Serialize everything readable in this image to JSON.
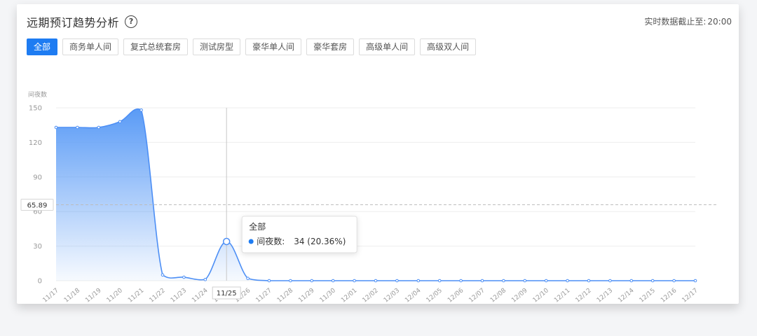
{
  "header": {
    "title": "远期预订趋势分析",
    "help_icon": "question-circle-icon",
    "cutoff_label": "实时数据截止至:",
    "cutoff_time": "20:00"
  },
  "tabs": [
    {
      "label": "全部",
      "active": true
    },
    {
      "label": "商务单人间",
      "active": false
    },
    {
      "label": "复式总统套房",
      "active": false
    },
    {
      "label": "测试房型",
      "active": false
    },
    {
      "label": "豪华单人间",
      "active": false
    },
    {
      "label": "豪华套房",
      "active": false
    },
    {
      "label": "高级单人间",
      "active": false
    },
    {
      "label": "高级双人间",
      "active": false
    }
  ],
  "colors": {
    "accent": "#1e7cf2",
    "line": "#4d8ff5",
    "area_top": "#5a9bf6",
    "grid": "#eeeeee",
    "axis_text": "#999999"
  },
  "chart_data": {
    "type": "area",
    "ylabel": "间夜数",
    "ylim": [
      0,
      150
    ],
    "yticks": [
      "150",
      "120",
      "90",
      "60",
      "30",
      "0"
    ],
    "categories": [
      "11/17",
      "11/18",
      "11/19",
      "11/20",
      "11/21",
      "11/22",
      "11/23",
      "11/24",
      "11/25",
      "11/26",
      "11/27",
      "11/28",
      "11/29",
      "11/30",
      "12/01",
      "12/02",
      "12/03",
      "12/04",
      "12/05",
      "12/06",
      "12/07",
      "12/08",
      "12/09",
      "12/10",
      "12/11",
      "12/12",
      "12/13",
      "12/14",
      "12/15",
      "12/16",
      "12/17"
    ],
    "series": [
      {
        "name": "间夜数",
        "values": [
          133,
          133,
          133,
          138,
          148,
          5,
          3,
          1,
          34,
          2,
          0,
          0,
          0,
          0,
          0,
          0,
          0,
          0,
          0,
          0,
          0,
          0,
          0,
          0,
          0,
          0,
          0,
          0,
          0,
          0,
          0
        ]
      }
    ],
    "reference_line": {
      "value": 65.89,
      "label": "65.89",
      "style": "dashed"
    },
    "tooltip": {
      "category": "11/25",
      "title": "全部",
      "series_label": "间夜数:",
      "value_text": "34 (20.36%)"
    },
    "grid": true,
    "legend": "none"
  }
}
